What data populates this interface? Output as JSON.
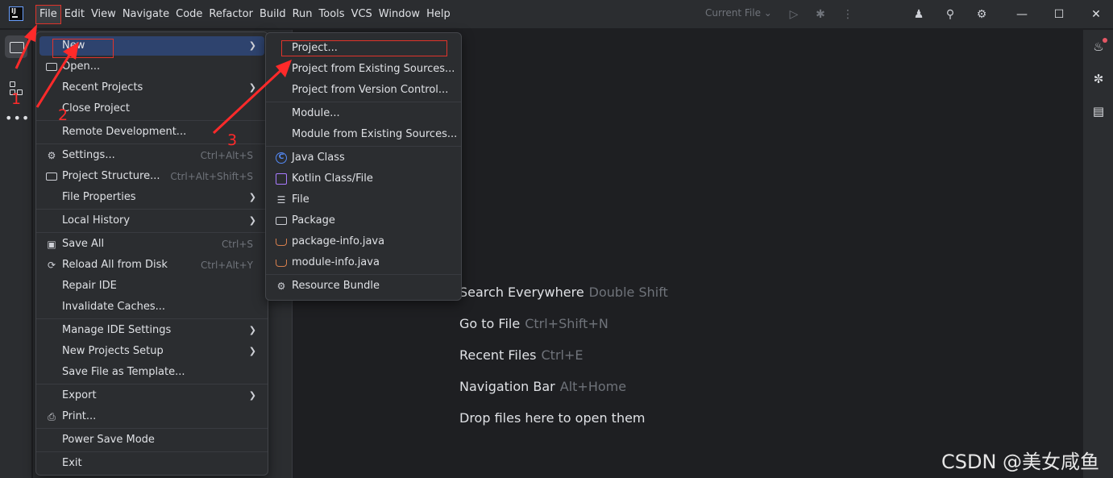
{
  "menubar": [
    "File",
    "Edit",
    "View",
    "Navigate",
    "Code",
    "Refactor",
    "Build",
    "Run",
    "Tools",
    "VCS",
    "Window",
    "Help"
  ],
  "run_config": "Current File",
  "file_menu": {
    "items": [
      {
        "label": "New",
        "submenu": true,
        "selected": true
      },
      {
        "label": "Open...",
        "icon": "folder-icon"
      },
      {
        "label": "Recent Projects",
        "submenu": true
      },
      {
        "label": "Close Project"
      },
      {
        "label": "Remote Development..."
      },
      {
        "label": "Settings...",
        "icon": "gear-icon",
        "shortcut": "Ctrl+Alt+S"
      },
      {
        "label": "Project Structure...",
        "icon": "project-structure-icon",
        "shortcut": "Ctrl+Alt+Shift+S"
      },
      {
        "label": "File Properties",
        "submenu": true
      },
      {
        "label": "Local History",
        "submenu": true
      },
      {
        "label": "Save All",
        "icon": "save-icon",
        "shortcut": "Ctrl+S"
      },
      {
        "label": "Reload All from Disk",
        "icon": "reload-icon",
        "shortcut": "Ctrl+Alt+Y"
      },
      {
        "label": "Repair IDE"
      },
      {
        "label": "Invalidate Caches..."
      },
      {
        "label": "Manage IDE Settings",
        "submenu": true
      },
      {
        "label": "New Projects Setup",
        "submenu": true
      },
      {
        "label": "Save File as Template..."
      },
      {
        "label": "Export",
        "submenu": true
      },
      {
        "label": "Print...",
        "icon": "print-icon"
      },
      {
        "label": "Power Save Mode"
      },
      {
        "label": "Exit"
      }
    ]
  },
  "new_submenu": {
    "items": [
      {
        "label": "Project..."
      },
      {
        "label": "Project from Existing Sources..."
      },
      {
        "label": "Project from Version Control..."
      },
      {
        "label": "Module..."
      },
      {
        "label": "Module from Existing Sources..."
      },
      {
        "label": "Java Class",
        "icon": "java-class-icon"
      },
      {
        "label": "Kotlin Class/File",
        "icon": "kotlin-icon"
      },
      {
        "label": "File",
        "icon": "file-icon"
      },
      {
        "label": "Package",
        "icon": "package-icon"
      },
      {
        "label": "package-info.java",
        "icon": "java-file-icon"
      },
      {
        "label": "module-info.java",
        "icon": "java-file-icon"
      },
      {
        "label": "Resource Bundle",
        "icon": "resource-bundle-icon"
      }
    ]
  },
  "editor_hints": [
    {
      "action": "Search Everywhere",
      "shortcut": "Double Shift"
    },
    {
      "action": "Go to File",
      "shortcut": "Ctrl+Shift+N"
    },
    {
      "action": "Recent Files",
      "shortcut": "Ctrl+E"
    },
    {
      "action": "Navigation Bar",
      "shortcut": "Alt+Home"
    },
    {
      "action": "Drop files here to open them",
      "shortcut": ""
    }
  ],
  "annotations": [
    "1",
    "2",
    "3"
  ],
  "watermark": "CSDN @美女咸鱼",
  "colors": {
    "annotation": "#e0342b",
    "selection": "#2e436e",
    "background": "#1e1f22",
    "panel": "#2b2d30"
  }
}
